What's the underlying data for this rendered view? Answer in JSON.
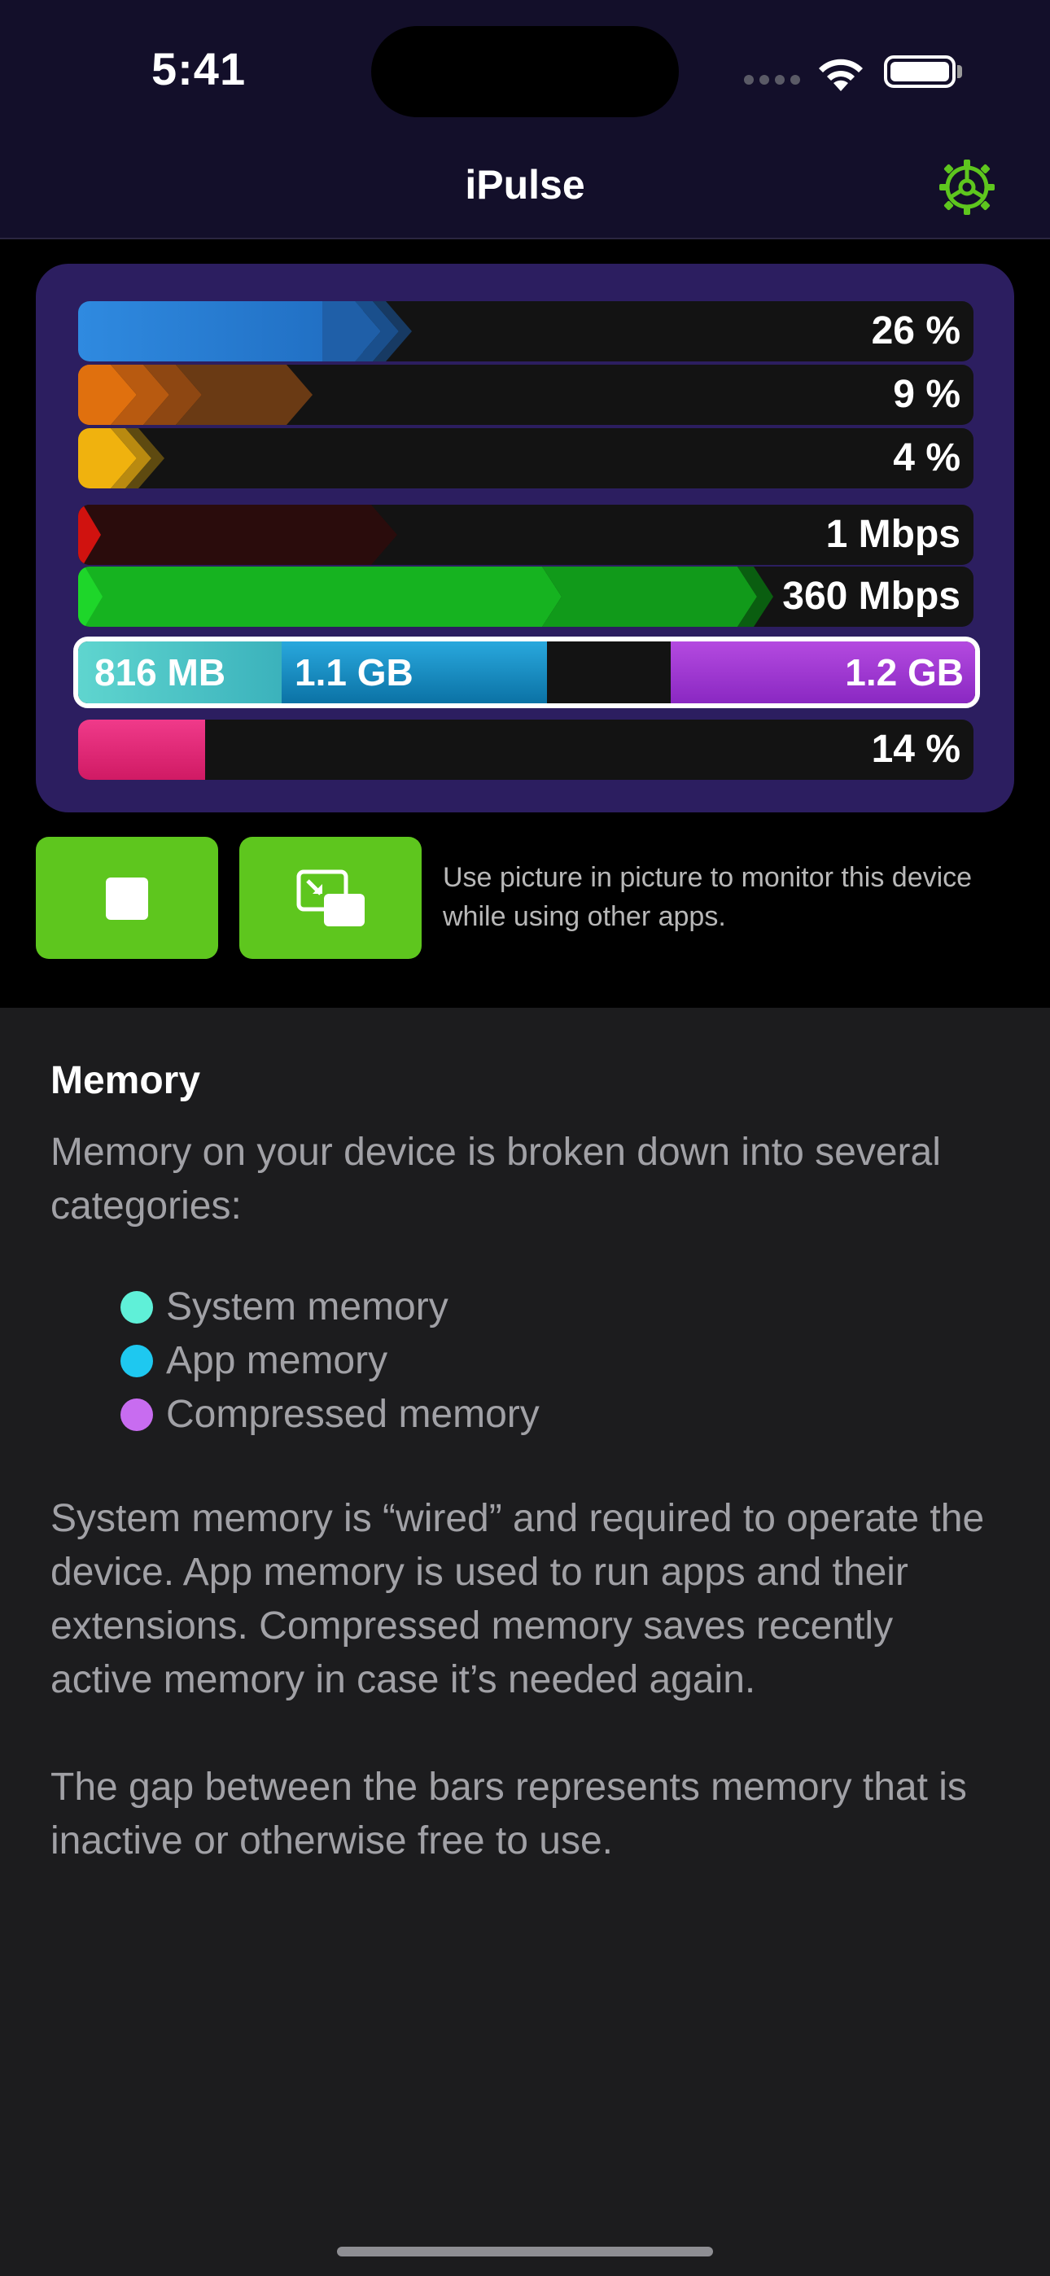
{
  "status": {
    "time": "5:41"
  },
  "nav": {
    "title": "iPulse",
    "settings_icon": "gear-icon",
    "accent": "#5ec61e"
  },
  "monitor": {
    "cpu_bars": [
      {
        "label": "26 %",
        "value_percent": 26,
        "color": "#2f8fe0"
      },
      {
        "label": "9 %",
        "value_percent": 9,
        "color": "#e0700e"
      },
      {
        "label": "4 %",
        "value_percent": 4,
        "color": "#f0b20e"
      }
    ],
    "network": {
      "upload": {
        "label": "1 Mbps",
        "color": "#c8100e"
      },
      "download": {
        "label": "360 Mbps",
        "color": "#12a81a"
      }
    },
    "memory": {
      "system": "816 MB",
      "app": "1.1 GB",
      "compressed": "1.2 GB"
    },
    "storage": {
      "label": "14 %",
      "value_percent": 14,
      "color": "#ec2a78"
    }
  },
  "controls": {
    "stop_icon": "stop-icon",
    "pip_icon": "picture-in-picture-icon",
    "pip_note": "Use picture in picture to monitor this device while using other apps."
  },
  "help": {
    "title": "Memory",
    "intro": "Memory on your device is broken down into several categories:",
    "legend": [
      {
        "label": "System memory",
        "color": "#5ff0d8"
      },
      {
        "label": "App memory",
        "color": "#1ec8f0"
      },
      {
        "label": "Compressed memory",
        "color": "#c86cf0"
      }
    ],
    "details": "System memory is “wired” and required to operate the device. App memory is used to run apps and their extensions. Compressed memory saves recently active memory in case it’s needed again.",
    "gap_note": "The gap between the bars represents memory that is inactive or otherwise free to use."
  }
}
